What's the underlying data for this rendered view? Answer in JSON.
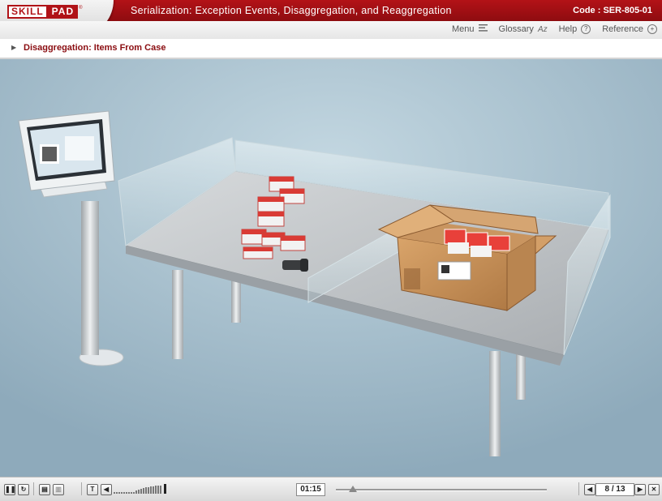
{
  "header": {
    "logo_skill": "SKILL",
    "logo_pad": "PAD",
    "logo_tm": "®",
    "course_title": "Serialization: Exception Events, Disaggregation, and Reaggregation",
    "code_label": "Code :",
    "code_value": "SER-805-01"
  },
  "nav": {
    "menu": "Menu",
    "glossary": "Glossary",
    "glossary_icon_text": "Az",
    "help": "Help",
    "help_icon_text": "?",
    "reference": "Reference",
    "reference_icon_text": "+"
  },
  "topic": {
    "title": "Disaggregation: Items From Case"
  },
  "player": {
    "elapsed_time": "01:15",
    "progress": 0.08,
    "volume_level": 1.0,
    "current_page": "8",
    "page_separator": "/",
    "total_pages": "13",
    "transcript_button_label": "T"
  },
  "colors": {
    "brand_red": "#a80f14",
    "topic_text": "#8a0c10",
    "scene_bg": "#a9c2cf"
  },
  "icons": {
    "menu": "menu-lines-icon",
    "glossary": "glossary-az-icon",
    "help": "help-circle-icon",
    "reference": "plus-circle-icon",
    "pause": "pause-icon",
    "replay": "replay-icon",
    "prev": "chevron-left-icon",
    "next": "chevron-right-icon",
    "close": "close-icon"
  }
}
